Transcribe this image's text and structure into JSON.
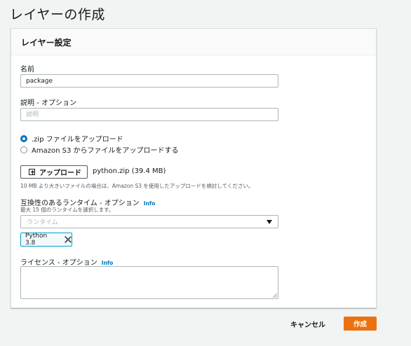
{
  "page": {
    "title": "レイヤーの作成"
  },
  "panel": {
    "title": "レイヤー設定"
  },
  "name_field": {
    "label": "名前",
    "value": "package"
  },
  "description_field": {
    "label": "説明 - オプション",
    "placeholder": "説明"
  },
  "upload_options": [
    {
      "label": ".zip ファイルをアップロード",
      "selected": true
    },
    {
      "label": "Amazon S3 からファイルをアップロードする",
      "selected": false
    }
  ],
  "upload": {
    "button_label": "アップロード",
    "icon": "upload-icon",
    "file_info": "python.zip (39.4 MB)",
    "hint": "10 MB より大きいファイルの場合は、Amazon S3 を使用したアップロードを検討してください。"
  },
  "runtime_field": {
    "label": "互換性のあるランタイム - オプション",
    "info": "Info",
    "hint": "最大 15 個のランタイムを選択します。",
    "placeholder": "ランタイム",
    "selected_tokens": [
      "Python 3.8"
    ]
  },
  "license_field": {
    "label": "ライセンス - オプション",
    "info": "Info",
    "value": ""
  },
  "actions": {
    "cancel_label": "キャンセル",
    "create_label": "作成"
  },
  "colors": {
    "accent": "#0073bb",
    "primary_button": "#ec7211",
    "token_border": "#00a1c9",
    "background": "#f2f3f3"
  }
}
